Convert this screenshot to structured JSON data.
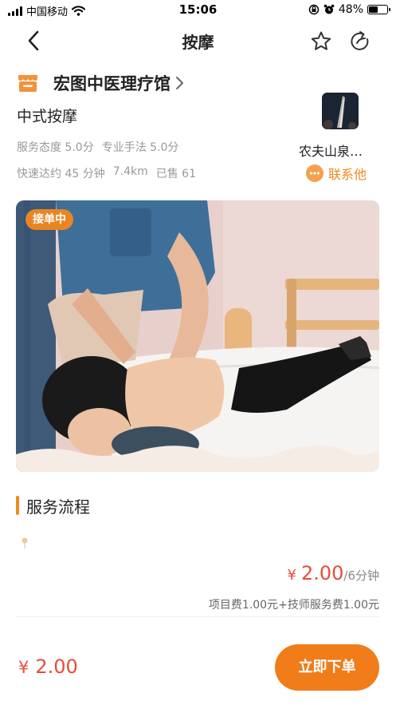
{
  "status_bar": {
    "carrier": "中国移动",
    "time": "15:06",
    "battery": "48%",
    "battery_level": 0.48
  },
  "nav": {
    "title": "按摩",
    "back_icon": "chevron-left-icon",
    "favorite_icon": "star-icon",
    "share_icon": "share-icon"
  },
  "shop": {
    "icon": "shop-icon",
    "name": "宏图中医理疗馆"
  },
  "service": {
    "name": "中式按摩",
    "ratings": [
      "服务态度 5.0分",
      "专业手法 5.0分"
    ],
    "stats": [
      "快速达约 45 分钟",
      "7.4km",
      "已售 61"
    ]
  },
  "technician": {
    "name": "农夫山泉…",
    "contact_label": "联系他"
  },
  "hero": {
    "badge": "接单中"
  },
  "section": {
    "title": "服务流程"
  },
  "pricing": {
    "currency": "¥",
    "price": "2.00",
    "unit": "/6分钟",
    "detail": "项目费1.00元+技师服务费1.00元"
  },
  "bottom": {
    "currency": "¥",
    "total": "2.00",
    "order_button": "立即下单"
  },
  "colors": {
    "accent": "#f07d1a",
    "price_red": "#e84b3c",
    "muted_text": "#999999"
  }
}
